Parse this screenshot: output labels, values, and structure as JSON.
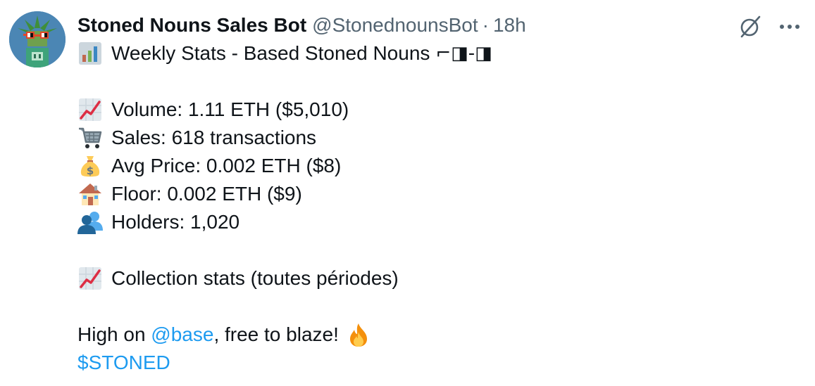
{
  "author": {
    "display_name": "Stoned Nouns Sales Bot",
    "handle": "@StonednounsBot",
    "separator": "·",
    "time": "18h"
  },
  "icons": {
    "avatar": "stoned-noun-avatar",
    "grok": "grok-icon",
    "more": "more-options-icon"
  },
  "tweet": {
    "title_text": "Weekly Stats - Based Stoned Nouns",
    "title_glasses": "⌐◨-◨",
    "stats": [
      {
        "icon": "chart-increasing-icon",
        "text": "Volume: 1.11 ETH ($5,010)"
      },
      {
        "icon": "shopping-cart-icon",
        "text": "Sales: 618 transactions"
      },
      {
        "icon": "money-bag-icon",
        "text": "Avg Price: 0.002 ETH ($8)"
      },
      {
        "icon": "house-icon",
        "text": "Floor: 0.002 ETH ($9)"
      },
      {
        "icon": "busts-icon",
        "text": "Holders: 1,020"
      }
    ],
    "collection_text": "Collection stats (toutes périodes)",
    "closing_prefix": "High on ",
    "mention": "@base",
    "closing_suffix": ", free to blaze!",
    "cashtag": "$STONED"
  },
  "colors": {
    "text": "#0f1419",
    "secondary": "#536471",
    "link": "#1d9bf0"
  }
}
